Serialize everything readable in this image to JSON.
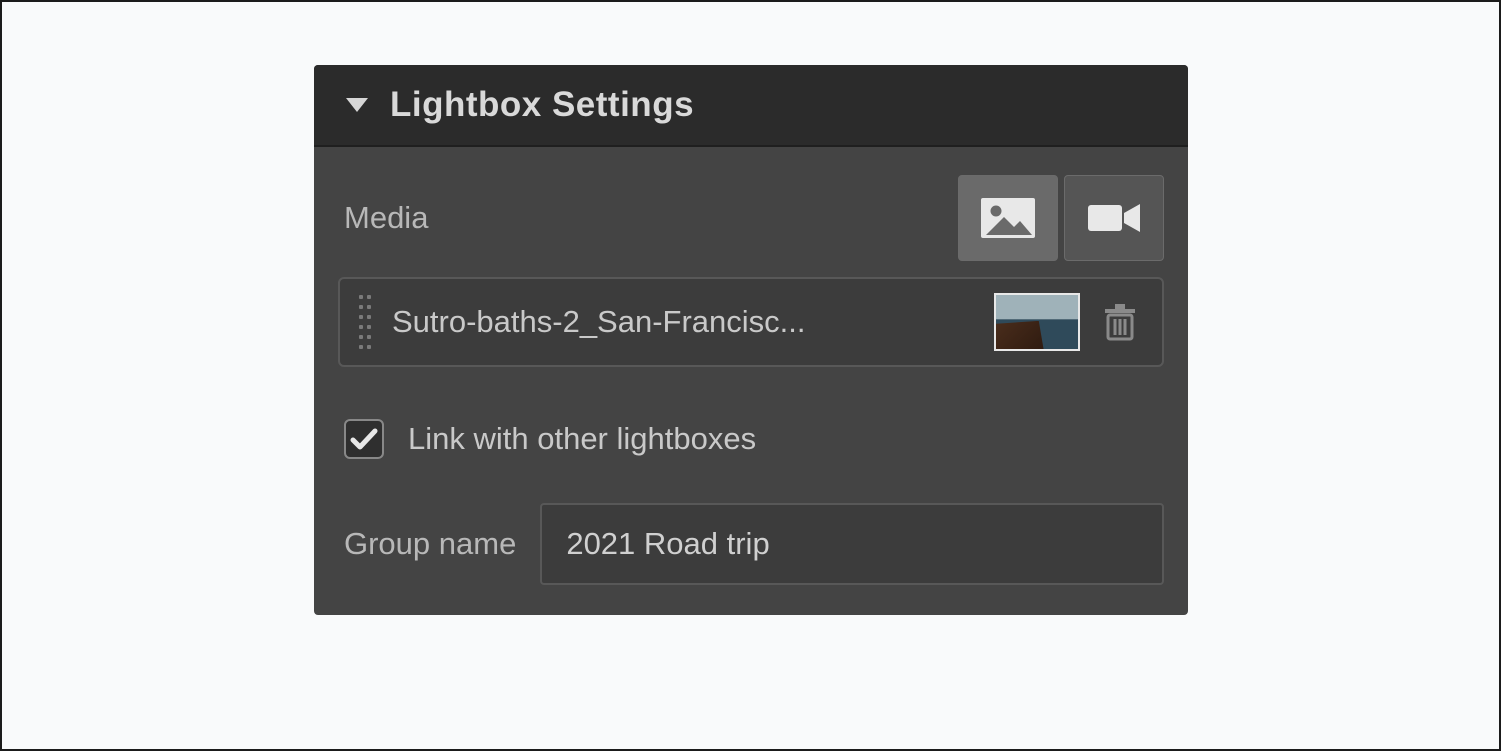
{
  "panel": {
    "title": "Lightbox Settings",
    "media_label": "Media",
    "buttons": {
      "image_icon": "image-icon",
      "video_icon": "video-camera-icon",
      "active": "image"
    },
    "item": {
      "file_name": "Sutro-baths-2_San-Francisc...",
      "thumbnail": "coastal-photo-thumbnail"
    },
    "link_checkbox": {
      "checked": true,
      "label": "Link with other lightboxes"
    },
    "group_name": {
      "label": "Group name",
      "value": "2021 Road trip"
    }
  }
}
